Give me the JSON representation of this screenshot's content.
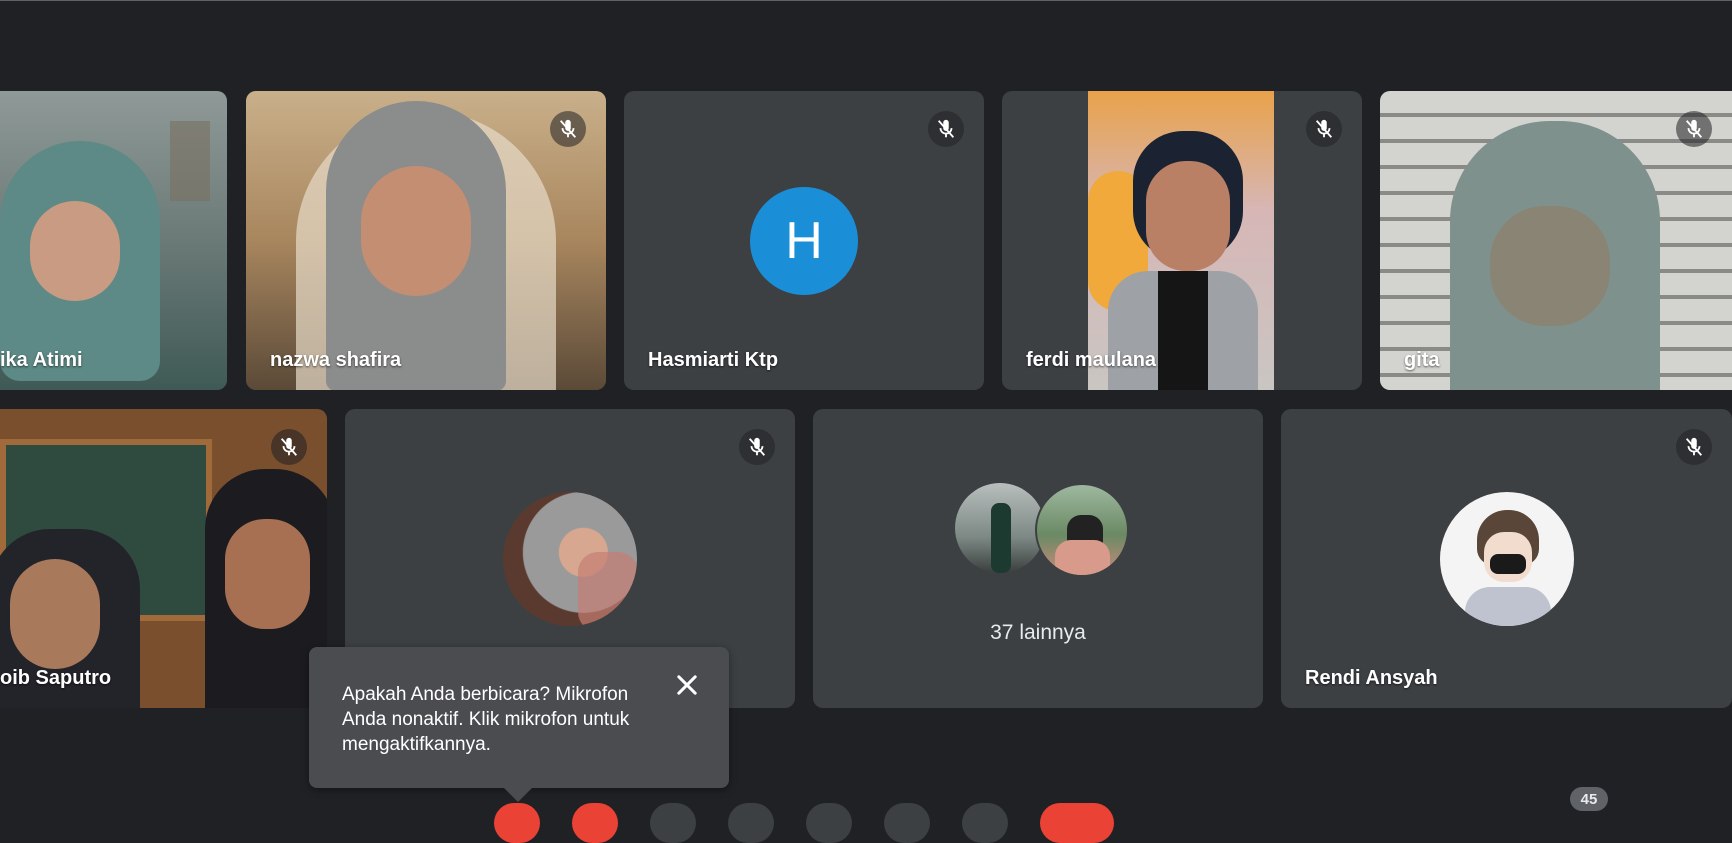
{
  "participants": {
    "p1": {
      "name": "ika Atimi"
    },
    "p2": {
      "name": "nazwa shafira"
    },
    "p3": {
      "name": "Hasmiarti Ktp",
      "initial": "H"
    },
    "p4": {
      "name": "ferdi maulana"
    },
    "p5": {
      "name": "gita"
    },
    "p6": {
      "name": "oib Saputro"
    },
    "p7": {
      "name": ""
    },
    "others": {
      "label": "37 lainnya"
    },
    "p8": {
      "name": "Rendi Ansyah"
    }
  },
  "toast": {
    "message": "Apakah Anda berbicara? Mikrofon Anda nonaktif. Klik mikrofon untuk mengaktifkannya."
  },
  "controls": {
    "participant_count": "45"
  },
  "colors": {
    "background": "#202124",
    "tile": "#3c4043",
    "avatar_blue": "#1a8fd8",
    "end_call_red": "#ea4335"
  }
}
